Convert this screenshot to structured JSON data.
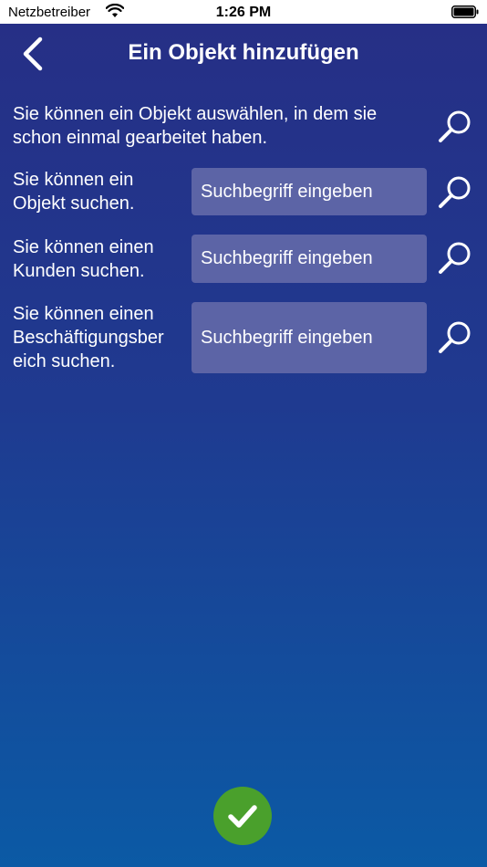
{
  "status_bar": {
    "carrier": "Netzbetreiber",
    "time": "1:26 PM",
    "wifi_icon": "wifi-icon",
    "battery_icon": "battery-icon"
  },
  "header": {
    "title": "Ein Objekt hinzufügen",
    "back_icon": "chevron-left-icon"
  },
  "intro": {
    "text": "Sie können ein Objekt auswählen, in dem sie schon einmal gearbeitet haben.",
    "search_icon": "magnifier-icon"
  },
  "rows": [
    {
      "label_line1": "Sie können ein",
      "label_line2": "Objekt suchen.",
      "label_line3": "",
      "placeholder": "Suchbegriff eingeben"
    },
    {
      "label_line1": "Sie können einen",
      "label_line2": "Kunden suchen.",
      "label_line3": "",
      "placeholder": "Suchbegriff eingeben"
    },
    {
      "label_line1": "Sie können einen",
      "label_line2": "Beschäftigungsber",
      "label_line3": "eich suchen.",
      "placeholder": "Suchbegriff eingeben"
    }
  ],
  "confirm": {
    "icon": "checkmark-icon"
  },
  "colors": {
    "background_top": "#262f86",
    "background_bottom": "#0b5aa5",
    "field": "#5c64a6",
    "confirm": "#4aa02c"
  }
}
